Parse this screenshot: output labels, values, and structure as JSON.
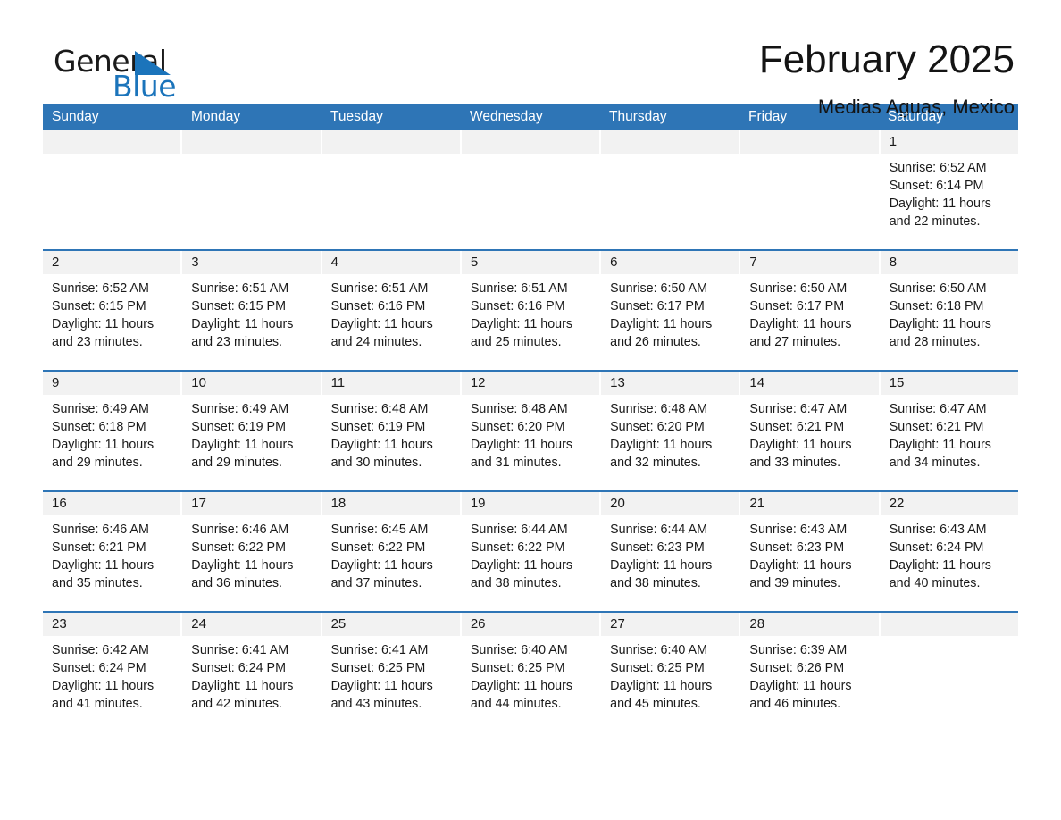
{
  "brand": {
    "name_part1": "General",
    "name_part2": "Blue",
    "triangle_icon": "triangle-icon",
    "accent_color": "#1b74bb"
  },
  "header": {
    "title": "February 2025",
    "location": "Medias Aguas, Mexico"
  },
  "calendar": {
    "header_color": "#2e75b6",
    "day_strip_color": "#f2f2f2",
    "weekdays": [
      "Sunday",
      "Monday",
      "Tuesday",
      "Wednesday",
      "Thursday",
      "Friday",
      "Saturday"
    ],
    "labels": {
      "sunrise": "Sunrise:",
      "sunset": "Sunset:",
      "daylight": "Daylight:"
    },
    "weeks": [
      [
        {
          "day": "",
          "empty": true
        },
        {
          "day": "",
          "empty": true
        },
        {
          "day": "",
          "empty": true
        },
        {
          "day": "",
          "empty": true
        },
        {
          "day": "",
          "empty": true
        },
        {
          "day": "",
          "empty": true
        },
        {
          "day": "1",
          "sunrise": "Sunrise: 6:52 AM",
          "sunset": "Sunset: 6:14 PM",
          "daylight": "Daylight: 11 hours and 22 minutes."
        }
      ],
      [
        {
          "day": "2",
          "sunrise": "Sunrise: 6:52 AM",
          "sunset": "Sunset: 6:15 PM",
          "daylight": "Daylight: 11 hours and 23 minutes."
        },
        {
          "day": "3",
          "sunrise": "Sunrise: 6:51 AM",
          "sunset": "Sunset: 6:15 PM",
          "daylight": "Daylight: 11 hours and 23 minutes."
        },
        {
          "day": "4",
          "sunrise": "Sunrise: 6:51 AM",
          "sunset": "Sunset: 6:16 PM",
          "daylight": "Daylight: 11 hours and 24 minutes."
        },
        {
          "day": "5",
          "sunrise": "Sunrise: 6:51 AM",
          "sunset": "Sunset: 6:16 PM",
          "daylight": "Daylight: 11 hours and 25 minutes."
        },
        {
          "day": "6",
          "sunrise": "Sunrise: 6:50 AM",
          "sunset": "Sunset: 6:17 PM",
          "daylight": "Daylight: 11 hours and 26 minutes."
        },
        {
          "day": "7",
          "sunrise": "Sunrise: 6:50 AM",
          "sunset": "Sunset: 6:17 PM",
          "daylight": "Daylight: 11 hours and 27 minutes."
        },
        {
          "day": "8",
          "sunrise": "Sunrise: 6:50 AM",
          "sunset": "Sunset: 6:18 PM",
          "daylight": "Daylight: 11 hours and 28 minutes."
        }
      ],
      [
        {
          "day": "9",
          "sunrise": "Sunrise: 6:49 AM",
          "sunset": "Sunset: 6:18 PM",
          "daylight": "Daylight: 11 hours and 29 minutes."
        },
        {
          "day": "10",
          "sunrise": "Sunrise: 6:49 AM",
          "sunset": "Sunset: 6:19 PM",
          "daylight": "Daylight: 11 hours and 29 minutes."
        },
        {
          "day": "11",
          "sunrise": "Sunrise: 6:48 AM",
          "sunset": "Sunset: 6:19 PM",
          "daylight": "Daylight: 11 hours and 30 minutes."
        },
        {
          "day": "12",
          "sunrise": "Sunrise: 6:48 AM",
          "sunset": "Sunset: 6:20 PM",
          "daylight": "Daylight: 11 hours and 31 minutes."
        },
        {
          "day": "13",
          "sunrise": "Sunrise: 6:48 AM",
          "sunset": "Sunset: 6:20 PM",
          "daylight": "Daylight: 11 hours and 32 minutes."
        },
        {
          "day": "14",
          "sunrise": "Sunrise: 6:47 AM",
          "sunset": "Sunset: 6:21 PM",
          "daylight": "Daylight: 11 hours and 33 minutes."
        },
        {
          "day": "15",
          "sunrise": "Sunrise: 6:47 AM",
          "sunset": "Sunset: 6:21 PM",
          "daylight": "Daylight: 11 hours and 34 minutes."
        }
      ],
      [
        {
          "day": "16",
          "sunrise": "Sunrise: 6:46 AM",
          "sunset": "Sunset: 6:21 PM",
          "daylight": "Daylight: 11 hours and 35 minutes."
        },
        {
          "day": "17",
          "sunrise": "Sunrise: 6:46 AM",
          "sunset": "Sunset: 6:22 PM",
          "daylight": "Daylight: 11 hours and 36 minutes."
        },
        {
          "day": "18",
          "sunrise": "Sunrise: 6:45 AM",
          "sunset": "Sunset: 6:22 PM",
          "daylight": "Daylight: 11 hours and 37 minutes."
        },
        {
          "day": "19",
          "sunrise": "Sunrise: 6:44 AM",
          "sunset": "Sunset: 6:22 PM",
          "daylight": "Daylight: 11 hours and 38 minutes."
        },
        {
          "day": "20",
          "sunrise": "Sunrise: 6:44 AM",
          "sunset": "Sunset: 6:23 PM",
          "daylight": "Daylight: 11 hours and 38 minutes."
        },
        {
          "day": "21",
          "sunrise": "Sunrise: 6:43 AM",
          "sunset": "Sunset: 6:23 PM",
          "daylight": "Daylight: 11 hours and 39 minutes."
        },
        {
          "day": "22",
          "sunrise": "Sunrise: 6:43 AM",
          "sunset": "Sunset: 6:24 PM",
          "daylight": "Daylight: 11 hours and 40 minutes."
        }
      ],
      [
        {
          "day": "23",
          "sunrise": "Sunrise: 6:42 AM",
          "sunset": "Sunset: 6:24 PM",
          "daylight": "Daylight: 11 hours and 41 minutes."
        },
        {
          "day": "24",
          "sunrise": "Sunrise: 6:41 AM",
          "sunset": "Sunset: 6:24 PM",
          "daylight": "Daylight: 11 hours and 42 minutes."
        },
        {
          "day": "25",
          "sunrise": "Sunrise: 6:41 AM",
          "sunset": "Sunset: 6:25 PM",
          "daylight": "Daylight: 11 hours and 43 minutes."
        },
        {
          "day": "26",
          "sunrise": "Sunrise: 6:40 AM",
          "sunset": "Sunset: 6:25 PM",
          "daylight": "Daylight: 11 hours and 44 minutes."
        },
        {
          "day": "27",
          "sunrise": "Sunrise: 6:40 AM",
          "sunset": "Sunset: 6:25 PM",
          "daylight": "Daylight: 11 hours and 45 minutes."
        },
        {
          "day": "28",
          "sunrise": "Sunrise: 6:39 AM",
          "sunset": "Sunset: 6:26 PM",
          "daylight": "Daylight: 11 hours and 46 minutes."
        },
        {
          "day": "",
          "empty": true
        }
      ]
    ]
  }
}
